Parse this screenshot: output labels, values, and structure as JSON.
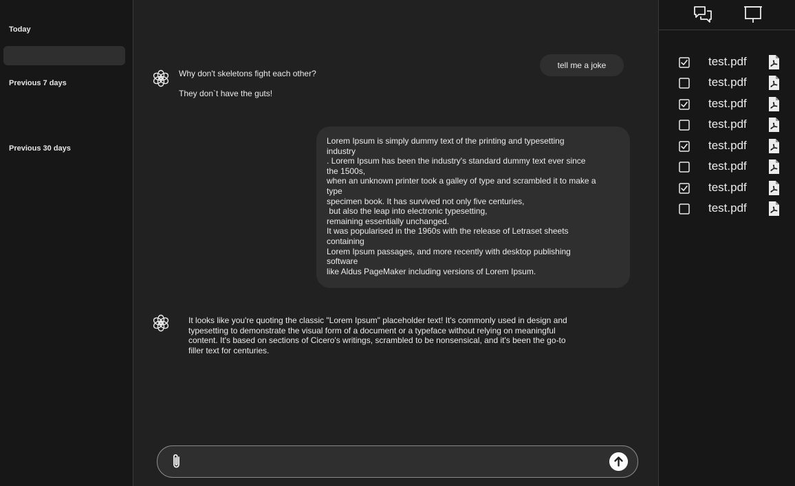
{
  "sidebar": {
    "sections": [
      {
        "label": "Today"
      },
      {
        "label": "Previous 7 days"
      },
      {
        "label": "Previous 30 days"
      }
    ]
  },
  "chat": {
    "user_message_1": "tell me a joke",
    "bot_message_1_line1": "Why don't skeletons fight each other?",
    "bot_message_1_line2": "They don`t have the guts!",
    "user_message_2": "Lorem Ipsum is simply dummy text of the printing and typesetting\nindustry\n. Lorem Ipsum has been the industry's standard dummy text ever since\nthe 1500s,\nwhen an unknown printer took a galley of type and scrambled it to make a\ntype\nspecimen book. It has survived not only five centuries,\n but also the leap into electronic typesetting,\nremaining essentially unchanged.\nIt was popularised in the 1960s with the release of Letraset sheets\ncontaining\nLorem Ipsum passages, and more recently with desktop publishing\nsoftware\nlike Aldus PageMaker including versions of Lorem Ipsum.",
    "bot_message_2_lines": [
      "It looks like you're quoting the classic \"Lorem Ipsum\" placeholder text! It's commonly used in design and",
      "typesetting to demonstrate the visual form of a document or a typeface without relying on meaningful",
      "content. It's based on sections of Cicero's writings, scrambled to be nonsensical, and it's been the go-to",
      "filler text for centuries."
    ]
  },
  "composer": {
    "value": "",
    "placeholder": ""
  },
  "right_panel": {
    "header_icons": [
      "chat-bubbles-icon",
      "presentation-board-icon"
    ],
    "files": [
      {
        "name": "test.pdf",
        "checked": true
      },
      {
        "name": "test.pdf",
        "checked": false
      },
      {
        "name": "test.pdf",
        "checked": true
      },
      {
        "name": "test.pdf",
        "checked": false
      },
      {
        "name": "test.pdf",
        "checked": true
      },
      {
        "name": "test.pdf",
        "checked": false
      },
      {
        "name": "test.pdf",
        "checked": true
      },
      {
        "name": "test.pdf",
        "checked": false
      }
    ]
  },
  "colors": {
    "background": "#212121",
    "sidebar": "#171717",
    "bubble": "#2f2f2f",
    "text": "#ececec"
  }
}
